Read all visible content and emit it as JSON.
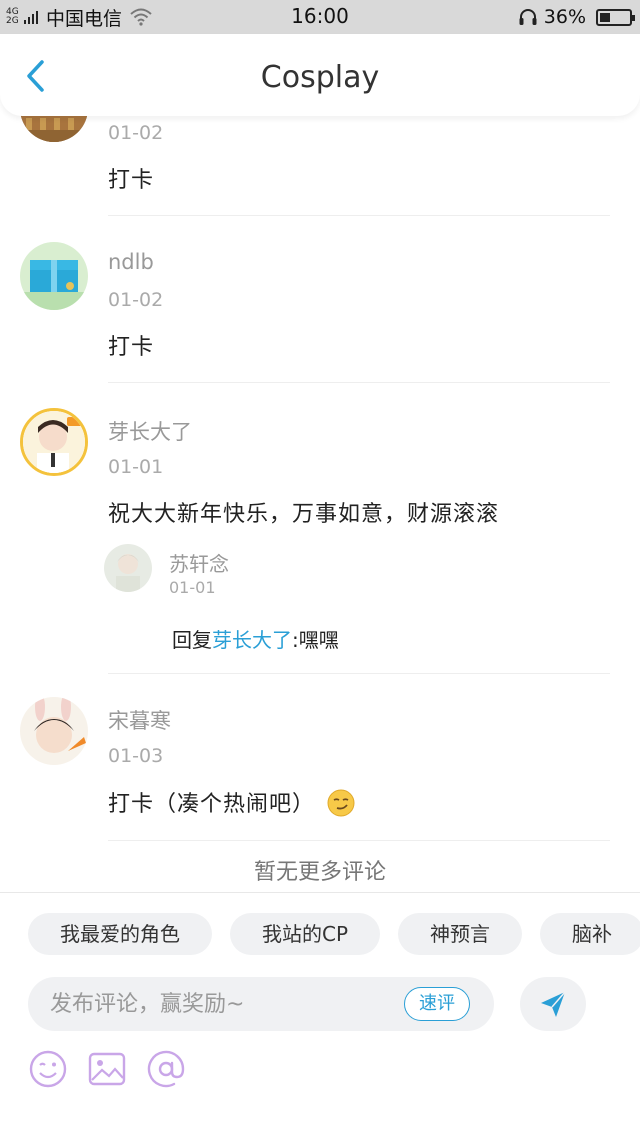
{
  "status_bar": {
    "network_label": "4G 2G",
    "carrier": "中国电信",
    "time": "16:00",
    "battery_percent": "36%",
    "battery_level": 0.36
  },
  "header": {
    "title": "Cosplay",
    "back_icon": "chevron-left-icon"
  },
  "comments": [
    {
      "name": "",
      "date": "01-02",
      "text": "打卡"
    },
    {
      "name": "ndlb",
      "date": "01-02",
      "text": "打卡"
    },
    {
      "name": "芽长大了",
      "date": "01-01",
      "text": "祝大大新年快乐，万事如意，财源滚滚",
      "reply": {
        "name": "苏轩念",
        "date": "01-01",
        "prefix": "回复",
        "mention": "芽长大了",
        "body": ":嘿嘿"
      }
    },
    {
      "name": "宋暮寒",
      "date": "01-03",
      "text": "打卡（凑个热闹吧）",
      "emoji": "smirk-emoji"
    }
  ],
  "no_more_text": "暂无更多评论",
  "input_panel": {
    "tags": [
      "我最爱的角色",
      "我站的CP",
      "神预言",
      "脑补"
    ],
    "placeholder": "发布评论，赢奖励~",
    "quick_button": "速评",
    "send_icon": "send-icon",
    "tools": [
      "emoji-icon",
      "image-icon",
      "at-icon"
    ]
  },
  "colors": {
    "accent": "#2a9fd6",
    "back_icon": "#2a9fd6",
    "tool_icon": "#c9a6e8",
    "status_bar_bg": "#d9d9d9"
  }
}
